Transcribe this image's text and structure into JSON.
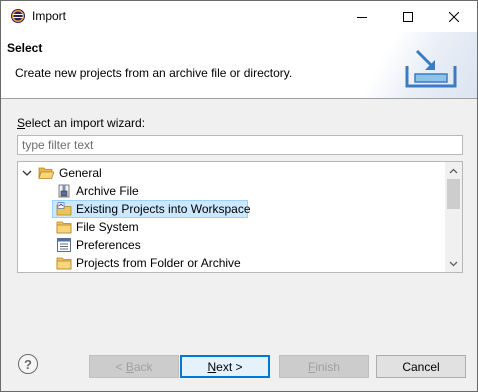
{
  "window": {
    "title": "Import",
    "controls": [
      "minimize-icon",
      "maximize-icon",
      "close-icon"
    ]
  },
  "banner": {
    "title": "Select",
    "description": "Create new projects from an archive file or directory."
  },
  "wizard": {
    "label_mnemonic": "S",
    "label_rest": "elect an import wizard:",
    "filter_placeholder": "type filter text",
    "tree": [
      {
        "label": "General",
        "icon": "folder-open-icon",
        "expanded": true,
        "level": 0
      },
      {
        "label": "Archive File",
        "icon": "archive-file-icon",
        "level": 1
      },
      {
        "label": "Existing Projects into Workspace",
        "icon": "existing-projects-icon",
        "level": 1,
        "selected": true
      },
      {
        "label": "File System",
        "icon": "folder-icon",
        "level": 1
      },
      {
        "label": "Preferences",
        "icon": "preferences-icon",
        "level": 1
      },
      {
        "label": "Projects from Folder or Archive",
        "icon": "folder-icon",
        "level": 1
      }
    ]
  },
  "buttons": {
    "help": "?",
    "back": {
      "prefix": "< ",
      "mnemonic": "B",
      "rest": "ack"
    },
    "next": {
      "mnemonic": "N",
      "rest": "ext >"
    },
    "finish": {
      "mnemonic": "F",
      "rest": "inish"
    },
    "cancel": "Cancel"
  },
  "colors": {
    "selection": "#cce8ff",
    "default_button_border": "#0078d7"
  }
}
